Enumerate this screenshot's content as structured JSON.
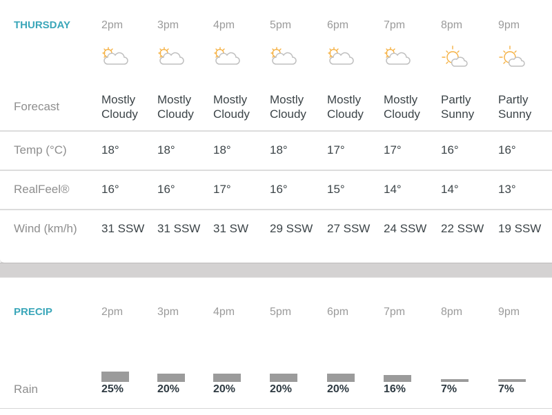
{
  "hourly": {
    "title": "THURSDAY",
    "hours": [
      "2pm",
      "3pm",
      "4pm",
      "5pm",
      "6pm",
      "7pm",
      "8pm",
      "9pm"
    ],
    "icons": [
      "mostly-cloudy-icon",
      "mostly-cloudy-icon",
      "mostly-cloudy-icon",
      "mostly-cloudy-icon",
      "mostly-cloudy-icon",
      "mostly-cloudy-icon",
      "partly-sunny-icon",
      "partly-sunny-icon"
    ],
    "rows": {
      "forecast": {
        "label": "Forecast",
        "values": [
          [
            "Mostly",
            "Cloudy"
          ],
          [
            "Mostly",
            "Cloudy"
          ],
          [
            "Mostly",
            "Cloudy"
          ],
          [
            "Mostly",
            "Cloudy"
          ],
          [
            "Mostly",
            "Cloudy"
          ],
          [
            "Mostly",
            "Cloudy"
          ],
          [
            "Partly",
            "Sunny"
          ],
          [
            "Partly",
            "Sunny"
          ]
        ]
      },
      "temp": {
        "label": "Temp (°C)",
        "values": [
          "18°",
          "18°",
          "18°",
          "18°",
          "17°",
          "17°",
          "16°",
          "16°"
        ]
      },
      "realfeel": {
        "label": "RealFeel®",
        "values": [
          "16°",
          "16°",
          "17°",
          "16°",
          "15°",
          "14°",
          "14°",
          "13°"
        ]
      },
      "wind": {
        "label": "Wind (km/h)",
        "values": [
          "31 SSW",
          "31 SSW",
          "31 SW",
          "29 SSW",
          "27 SSW",
          "24 SSW",
          "22 SSW",
          "19 SSW"
        ]
      }
    }
  },
  "precip": {
    "title": "PRECIP",
    "hours": [
      "2pm",
      "3pm",
      "4pm",
      "5pm",
      "6pm",
      "7pm",
      "8pm",
      "9pm"
    ],
    "rain": {
      "label": "Rain",
      "percent_labels": [
        "25%",
        "20%",
        "20%",
        "20%",
        "20%",
        "16%",
        "7%",
        "7%"
      ],
      "percent_values": [
        25,
        20,
        20,
        20,
        20,
        16,
        7,
        7
      ]
    }
  },
  "colors": {
    "accent": "#3aa6b9",
    "sun": "#f5b041",
    "cloud": "#bfbfbf",
    "bar": "#9b9b9b"
  }
}
